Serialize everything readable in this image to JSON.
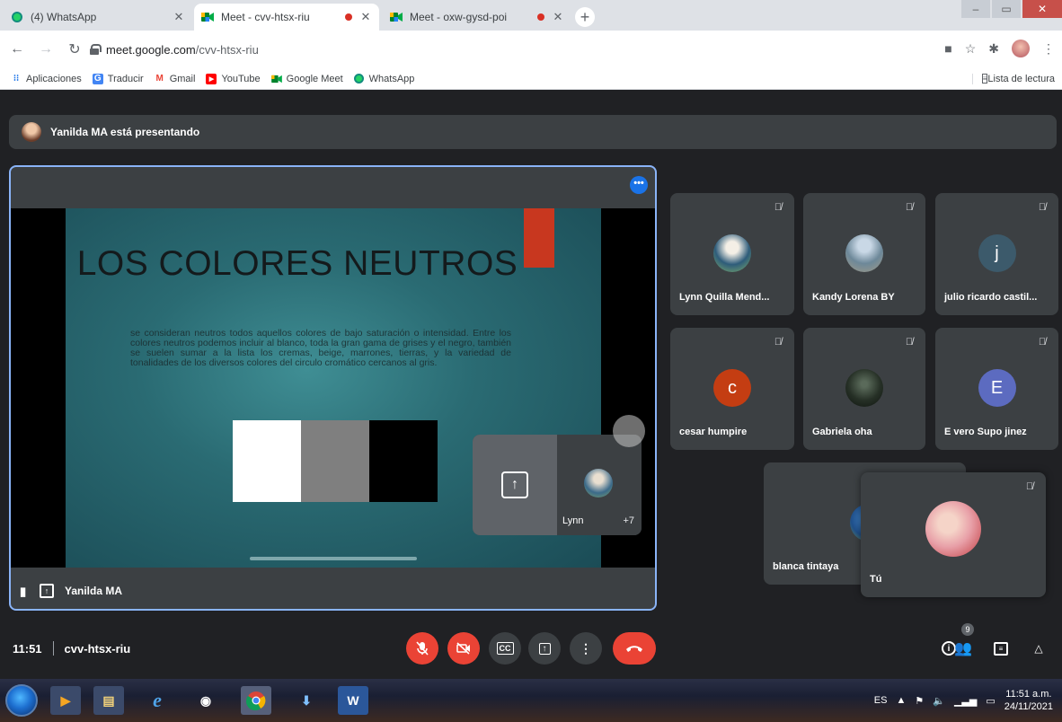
{
  "browser": {
    "tabs": [
      {
        "title": "(4) WhatsApp",
        "icon": "whatsapp-icon",
        "recording": false,
        "active": false
      },
      {
        "title": "Meet - cvv-htsx-riu",
        "icon": "google-meet-icon",
        "recording": true,
        "active": true
      },
      {
        "title": "Meet - oxw-gysd-poi",
        "icon": "google-meet-icon",
        "recording": true,
        "active": false
      }
    ],
    "new_tab": "+",
    "url_host": "meet.google.com",
    "url_path": "/cvv-htsx-riu",
    "bookmarks": [
      {
        "label": "Aplicaciones",
        "icon": "apps-grid-icon"
      },
      {
        "label": "Traducir",
        "icon": "google-translate-icon"
      },
      {
        "label": "Gmail",
        "icon": "gmail-icon"
      },
      {
        "label": "YouTube",
        "icon": "youtube-icon"
      },
      {
        "label": "Google Meet",
        "icon": "google-meet-icon"
      },
      {
        "label": "WhatsApp",
        "icon": "whatsapp-icon"
      }
    ],
    "reading_list": "Lista de lectura"
  },
  "meet": {
    "presenting_text": "Yanilda MA está presentando",
    "presenter_name": "Yanilda MA",
    "slide": {
      "title": "LOS COLORES NEUTROS",
      "body": "se consideran neutros todos aquellos colores de bajo saturación o intensidad. Entre los colores neutros podemos incluir al blanco, toda la gran gama de grises y el negro, también se suelen sumar a la lista los cremas, beige, marrones, tierras, y la variedad de tonalidades de los diversos colores del circulo cromático cercanos al gris.",
      "swatch_colors": [
        "#ffffff",
        "#7f7f7f",
        "#000000"
      ],
      "accent_color": "#c8371f"
    },
    "self_tile": {
      "name": "Lynn",
      "more_count": "+7"
    },
    "participants": [
      {
        "name": "Lynn Quilla Mend...",
        "type": "photo"
      },
      {
        "name": "Kandy Lorena BY",
        "type": "photo"
      },
      {
        "name": "julio ricardo castil...",
        "type": "letter",
        "letter": "j",
        "color": "#3c5a6b"
      },
      {
        "name": "cesar humpire",
        "type": "letter",
        "letter": "c",
        "color": "#c43d12"
      },
      {
        "name": "Gabriela oha",
        "type": "photo"
      },
      {
        "name": "E vero Supo jinez",
        "type": "letter",
        "letter": "E",
        "color": "#5c6bc0"
      },
      {
        "name": "blanca tintaya",
        "type": "photo"
      },
      {
        "name": "Tú",
        "type": "photo"
      }
    ],
    "bottom": {
      "time": "11:51",
      "meeting_code": "cvv-htsx-riu",
      "participant_badge": "9"
    }
  },
  "os": {
    "language": "ES",
    "time": "11:51 a.m.",
    "date": "24/11/2021"
  }
}
